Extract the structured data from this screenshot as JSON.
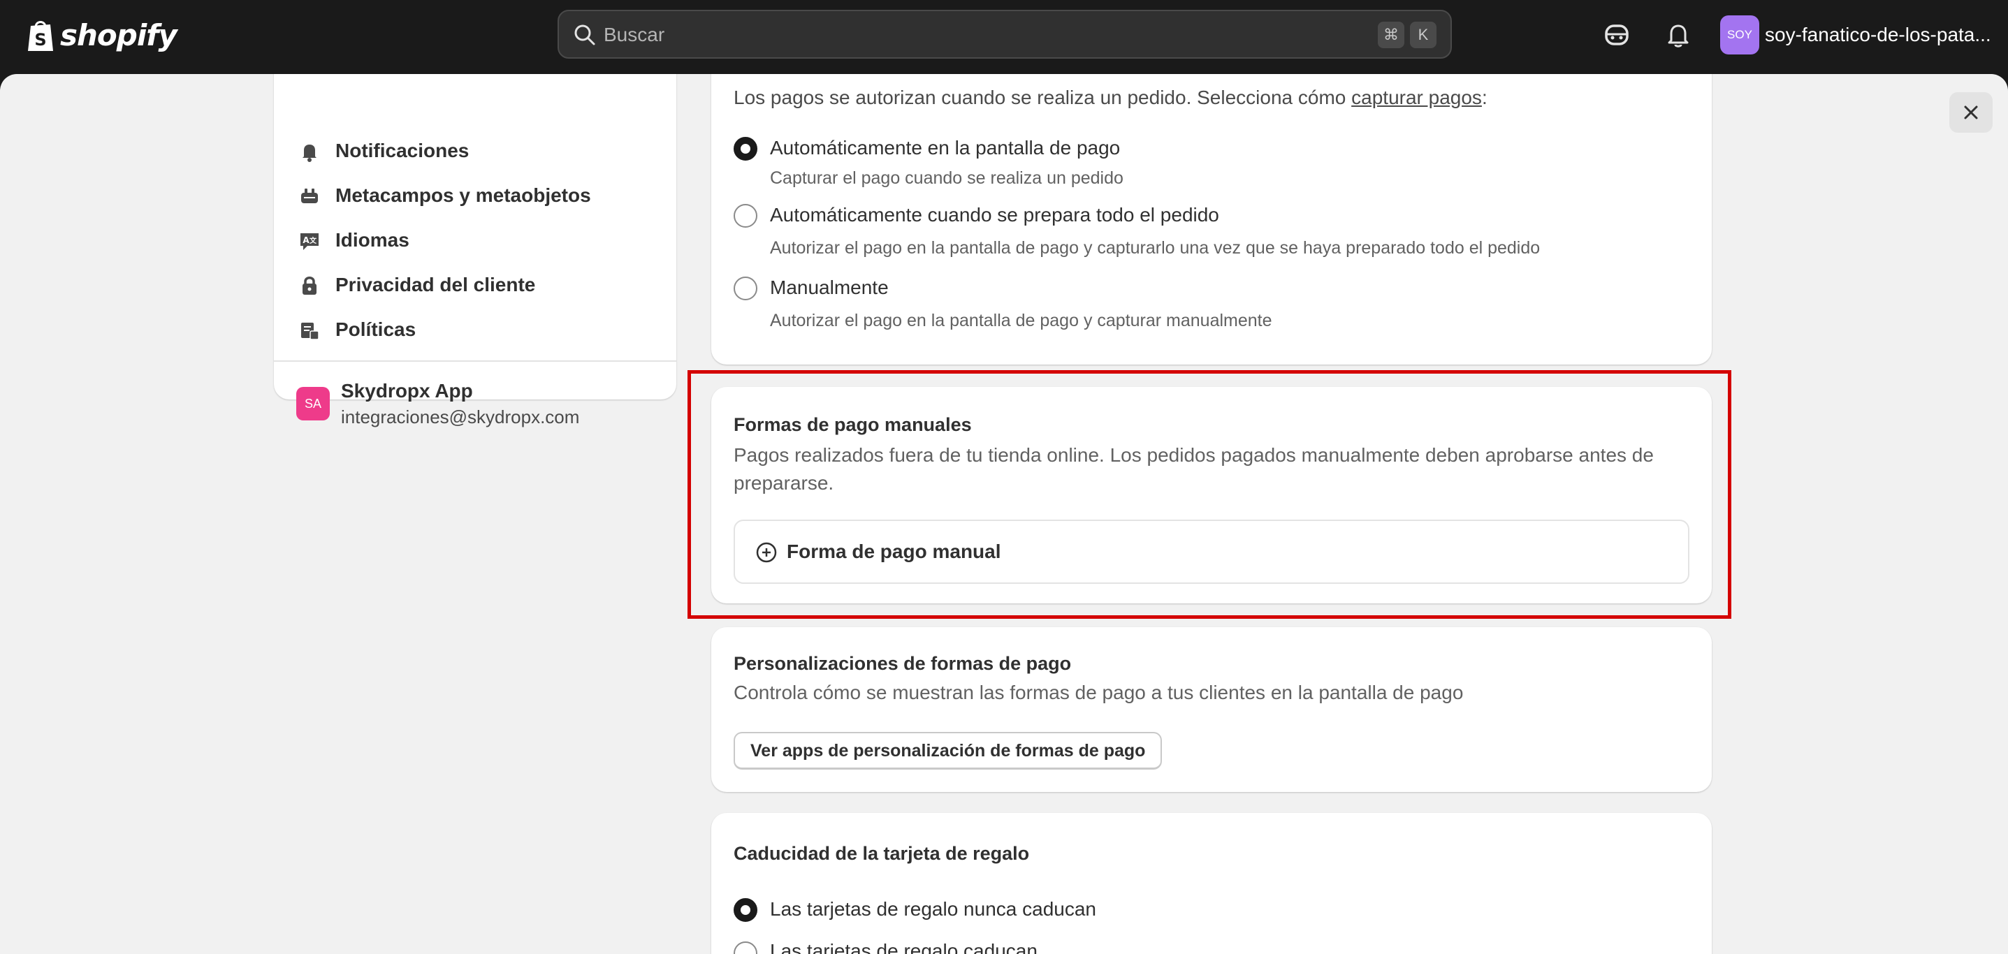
{
  "app": {
    "brand": "shopify"
  },
  "topbar": {
    "search_placeholder": "Buscar",
    "shortcut_cmd": "⌘",
    "shortcut_key": "K",
    "store_initials": "SOY",
    "store_name": "soy-fanatico-de-los-pata..."
  },
  "sidebar": {
    "items": [
      {
        "label": "Notificaciones",
        "icon": "bell-icon"
      },
      {
        "label": "Metacampos y metaobjetos",
        "icon": "metafields-icon"
      },
      {
        "label": "Idiomas",
        "icon": "languages-icon"
      },
      {
        "label": "Privacidad del cliente",
        "icon": "lock-icon"
      },
      {
        "label": "Políticas",
        "icon": "policies-icon"
      }
    ],
    "app": {
      "initials": "SA",
      "name": "Skydropx App",
      "email": "integraciones@skydropx.com"
    }
  },
  "capture": {
    "intro": "Los pagos se autorizan cuando se realiza un pedido. Selecciona cómo ",
    "intro_link": "capturar pagos",
    "intro_end": ":",
    "options": [
      {
        "label": "Automáticamente en la pantalla de pago",
        "help": "Capturar el pago cuando se realiza un pedido",
        "checked": true
      },
      {
        "label": "Automáticamente cuando se prepara todo el pedido",
        "help": "Autorizar el pago en la pantalla de pago y capturarlo una vez que se haya preparado todo el pedido",
        "checked": false
      },
      {
        "label": "Manualmente",
        "help": "Autorizar el pago en la pantalla de pago y capturar manualmente",
        "checked": false
      }
    ]
  },
  "manual_methods": {
    "title": "Formas de pago manuales",
    "description": "Pagos realizados fuera de tu tienda online. Los pedidos pagados manualmente deben aprobarse antes de prepararse.",
    "add_label": "Forma de pago manual"
  },
  "customizations": {
    "title": "Personalizaciones de formas de pago",
    "description": "Controla cómo se muestran las formas de pago a tus clientes en la pantalla de pago",
    "button_label": "Ver apps de personalización de formas de pago"
  },
  "gift_card": {
    "title": "Caducidad de la tarjeta de regalo",
    "options": [
      {
        "label": "Las tarjetas de regalo nunca caducan",
        "checked": true
      },
      {
        "label": "Las tarjetas de regalo caducan",
        "checked": false
      }
    ]
  },
  "colors": {
    "highlight": "#d40000",
    "brand_topbar": "#1a1a1a",
    "avatar": "#a374f0",
    "app_badge": "#ee3b8a"
  }
}
